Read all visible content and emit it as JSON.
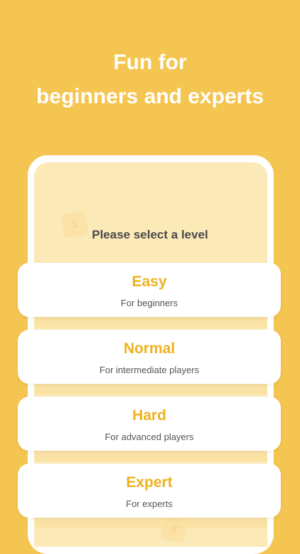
{
  "headline": {
    "line1": "Fun for",
    "line2": "beginners and experts"
  },
  "screen": {
    "prompt": "Please select a level",
    "tiles": [
      "1",
      "8"
    ]
  },
  "levels": [
    {
      "title": "Easy",
      "subtitle": "For beginners"
    },
    {
      "title": "Normal",
      "subtitle": "For intermediate players"
    },
    {
      "title": "Hard",
      "subtitle": "For advanced players"
    },
    {
      "title": "Expert",
      "subtitle": "For experts"
    }
  ],
  "colors": {
    "background": "#F5C551",
    "accent": "#EEB21E",
    "screen": "#FCE9B8"
  }
}
